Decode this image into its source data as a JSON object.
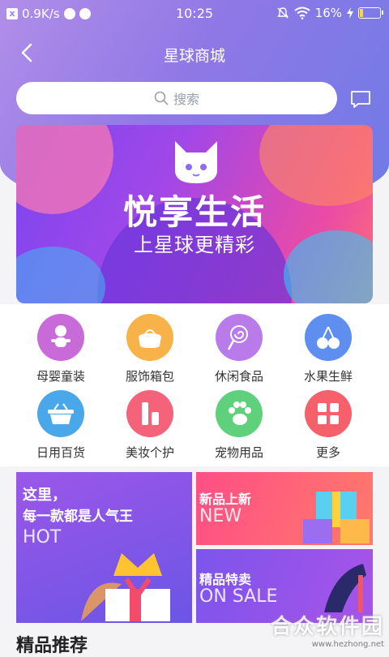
{
  "status_bar": {
    "speed": "0.9K/s",
    "time": "10:25",
    "battery": "16%",
    "battery_level": 0.16
  },
  "header": {
    "title": "星球商城",
    "search_placeholder": "搜索"
  },
  "banner": {
    "headline": "悦享生活",
    "subline": "上星球更精彩"
  },
  "categories": [
    {
      "label": "母婴童装",
      "icon": "baby-icon",
      "color": "#c86ad8"
    },
    {
      "label": "服饰箱包",
      "icon": "handbag-icon",
      "color": "#f7b24a"
    },
    {
      "label": "休闲食品",
      "icon": "lollipop-icon",
      "color": "#b97bea"
    },
    {
      "label": "水果生鲜",
      "icon": "cherry-icon",
      "color": "#5d8ef0"
    },
    {
      "label": "日用百货",
      "icon": "basket-icon",
      "color": "#4aa8ea"
    },
    {
      "label": "美妆个护",
      "icon": "cosmetics-icon",
      "color": "#f4637a"
    },
    {
      "label": "宠物用品",
      "icon": "paw-icon",
      "color": "#5fd07b"
    },
    {
      "label": "更多",
      "icon": "grid-icon",
      "color": "#f6606a"
    }
  ],
  "promos": {
    "big": {
      "line1": "这里，",
      "line2": "每一款都是人气王",
      "line3": "HOT"
    },
    "new": {
      "title": "新品上新",
      "sub": "NEW"
    },
    "sale": {
      "title": "精品特卖",
      "sub": "ON SALE"
    }
  },
  "section": {
    "title": "精品推荐"
  },
  "watermark": {
    "name": "合众软件园",
    "url": "www.hezhong.net"
  }
}
